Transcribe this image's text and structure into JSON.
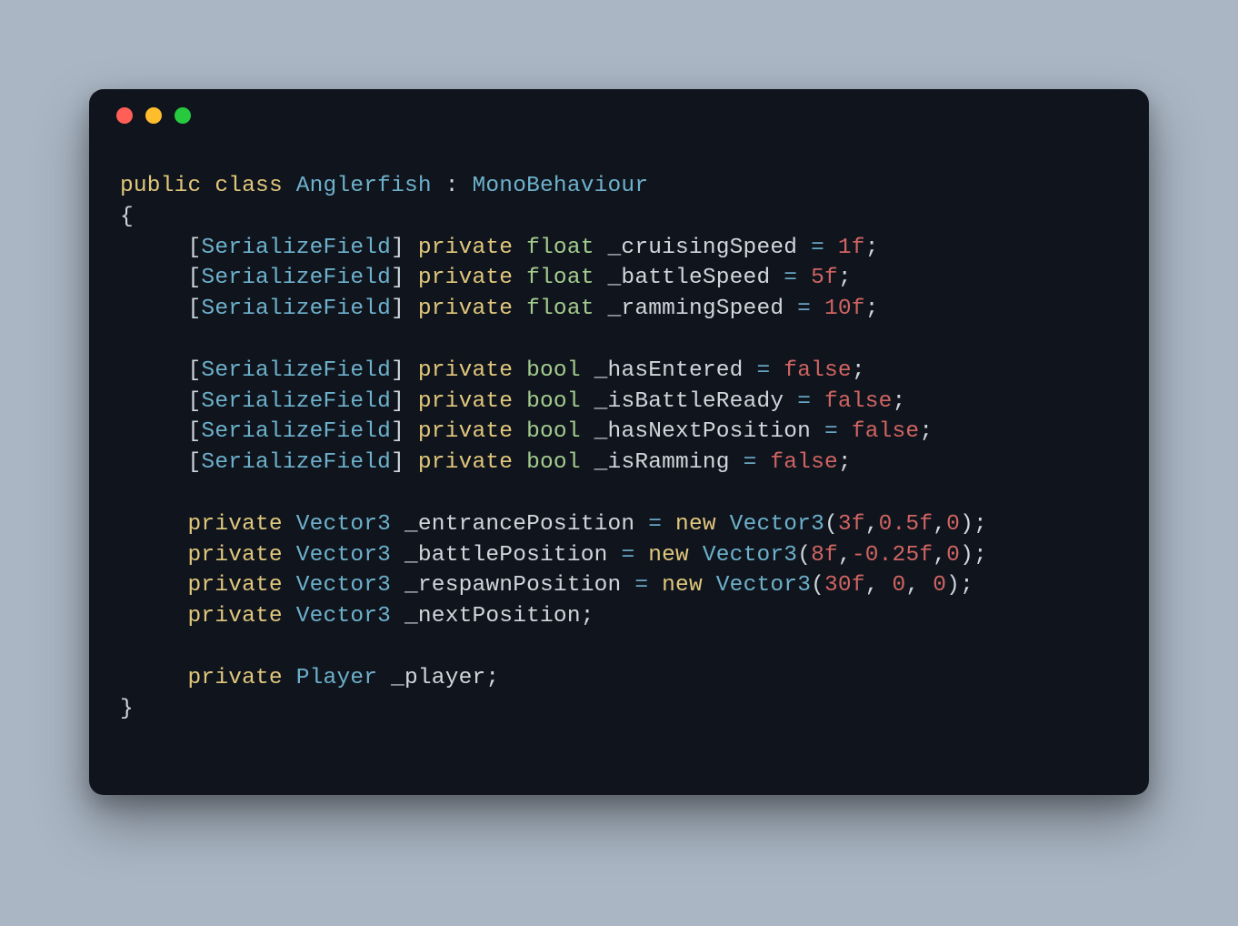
{
  "code": {
    "class_decl": {
      "kw_public": "public",
      "kw_class": "class",
      "name": "Anglerfish",
      "colon": ":",
      "base": "MonoBehaviour"
    },
    "brace_open": "{",
    "brace_close": "}",
    "attr_open": "[",
    "attr_close": "]",
    "attr_name": "SerializeField",
    "kw_private": "private",
    "kw_new": "new",
    "type_float": "float",
    "type_bool": "bool",
    "type_vector3": "Vector3",
    "type_player": "Player",
    "eq": "=",
    "semi": ";",
    "paren_open": "(",
    "paren_close": ")",
    "comma": ",",
    "fields_float": [
      {
        "name": "_cruisingSpeed",
        "value": "1f"
      },
      {
        "name": "_battleSpeed",
        "value": "5f"
      },
      {
        "name": "_rammingSpeed",
        "value": "10f"
      }
    ],
    "fields_bool": [
      {
        "name": "_hasEntered",
        "value": "false"
      },
      {
        "name": "_isBattleReady",
        "value": "false"
      },
      {
        "name": "_hasNextPosition",
        "value": "false"
      },
      {
        "name": "_isRamming",
        "value": "false"
      }
    ],
    "fields_vector_init": [
      {
        "name": "_entrancePosition",
        "args": [
          "3f",
          "0.5f",
          "0"
        ],
        "spaced": false
      },
      {
        "name": "_battlePosition",
        "args": [
          "8f",
          "-0.25f",
          "0"
        ],
        "spaced": false
      },
      {
        "name": "_respawnPosition",
        "args": [
          "30f",
          "0",
          "0"
        ],
        "spaced": true
      }
    ],
    "field_vector_plain": {
      "name": "_nextPosition"
    },
    "field_player": {
      "name": "_player"
    }
  }
}
